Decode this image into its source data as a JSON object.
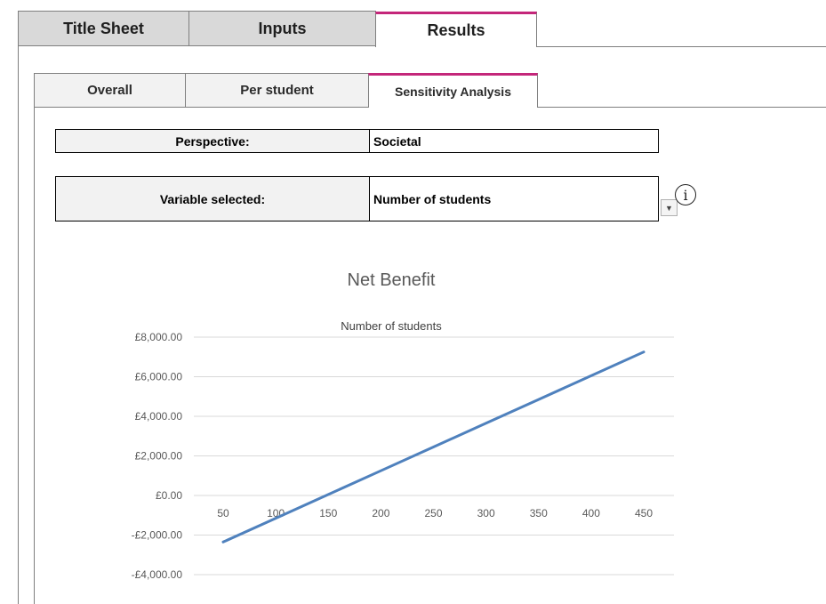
{
  "outer_tabs": [
    {
      "label": "Title Sheet"
    },
    {
      "label": "Inputs"
    },
    {
      "label": "Results"
    }
  ],
  "inner_tabs": [
    {
      "label": "Overall"
    },
    {
      "label": "Per student"
    },
    {
      "label": "Sensitivity Analysis"
    }
  ],
  "perspective": {
    "label": "Perspective:",
    "value": "Societal"
  },
  "variable": {
    "label": "Variable selected:",
    "value": "Number of students"
  },
  "info_icon": {
    "glyph": "i"
  },
  "dropdown": {
    "glyph": "▼"
  },
  "colors": {
    "accent": "#c4267a",
    "series": "#4f81bd"
  },
  "chart_data": {
    "type": "line",
    "title": "Net Benefit",
    "subtitle": "Number of students",
    "x": [
      50,
      100,
      150,
      200,
      250,
      300,
      350,
      400,
      450
    ],
    "xticks": [
      "50",
      "100",
      "150",
      "200",
      "250",
      "300",
      "350",
      "400",
      "450"
    ],
    "series": [
      {
        "values": [
          -2350,
          -1150,
          50,
          1250,
          2450,
          3650,
          4850,
          6050,
          7250
        ]
      }
    ],
    "yticks": [
      "£8,000.00",
      "£6,000.00",
      "£4,000.00",
      "£2,000.00",
      "£0.00",
      "-£2,000.00",
      "-£4,000.00"
    ],
    "ytick_values": [
      8000,
      6000,
      4000,
      2000,
      0,
      -2000,
      -4000
    ],
    "ylim": [
      -4000,
      8000
    ],
    "grid": true
  }
}
